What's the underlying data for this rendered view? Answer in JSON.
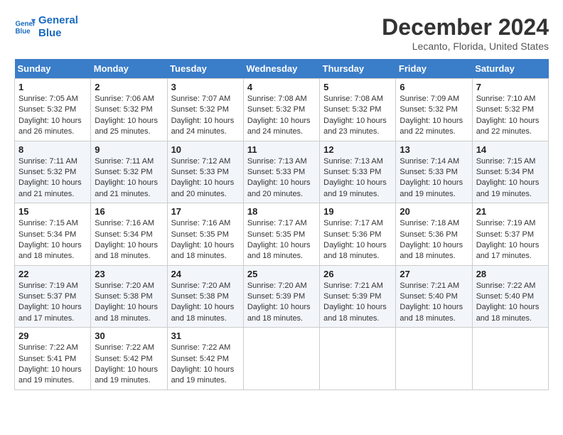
{
  "logo": {
    "line1": "General",
    "line2": "Blue"
  },
  "title": "December 2024",
  "location": "Lecanto, Florida, United States",
  "columns": [
    "Sunday",
    "Monday",
    "Tuesday",
    "Wednesday",
    "Thursday",
    "Friday",
    "Saturday"
  ],
  "weeks": [
    [
      {
        "day": "1",
        "sunrise": "7:05 AM",
        "sunset": "5:32 PM",
        "daylight": "10 hours and 26 minutes."
      },
      {
        "day": "2",
        "sunrise": "7:06 AM",
        "sunset": "5:32 PM",
        "daylight": "10 hours and 25 minutes."
      },
      {
        "day": "3",
        "sunrise": "7:07 AM",
        "sunset": "5:32 PM",
        "daylight": "10 hours and 24 minutes."
      },
      {
        "day": "4",
        "sunrise": "7:08 AM",
        "sunset": "5:32 PM",
        "daylight": "10 hours and 24 minutes."
      },
      {
        "day": "5",
        "sunrise": "7:08 AM",
        "sunset": "5:32 PM",
        "daylight": "10 hours and 23 minutes."
      },
      {
        "day": "6",
        "sunrise": "7:09 AM",
        "sunset": "5:32 PM",
        "daylight": "10 hours and 22 minutes."
      },
      {
        "day": "7",
        "sunrise": "7:10 AM",
        "sunset": "5:32 PM",
        "daylight": "10 hours and 22 minutes."
      }
    ],
    [
      {
        "day": "8",
        "sunrise": "7:11 AM",
        "sunset": "5:32 PM",
        "daylight": "10 hours and 21 minutes."
      },
      {
        "day": "9",
        "sunrise": "7:11 AM",
        "sunset": "5:32 PM",
        "daylight": "10 hours and 21 minutes."
      },
      {
        "day": "10",
        "sunrise": "7:12 AM",
        "sunset": "5:33 PM",
        "daylight": "10 hours and 20 minutes."
      },
      {
        "day": "11",
        "sunrise": "7:13 AM",
        "sunset": "5:33 PM",
        "daylight": "10 hours and 20 minutes."
      },
      {
        "day": "12",
        "sunrise": "7:13 AM",
        "sunset": "5:33 PM",
        "daylight": "10 hours and 19 minutes."
      },
      {
        "day": "13",
        "sunrise": "7:14 AM",
        "sunset": "5:33 PM",
        "daylight": "10 hours and 19 minutes."
      },
      {
        "day": "14",
        "sunrise": "7:15 AM",
        "sunset": "5:34 PM",
        "daylight": "10 hours and 19 minutes."
      }
    ],
    [
      {
        "day": "15",
        "sunrise": "7:15 AM",
        "sunset": "5:34 PM",
        "daylight": "10 hours and 18 minutes."
      },
      {
        "day": "16",
        "sunrise": "7:16 AM",
        "sunset": "5:34 PM",
        "daylight": "10 hours and 18 minutes."
      },
      {
        "day": "17",
        "sunrise": "7:16 AM",
        "sunset": "5:35 PM",
        "daylight": "10 hours and 18 minutes."
      },
      {
        "day": "18",
        "sunrise": "7:17 AM",
        "sunset": "5:35 PM",
        "daylight": "10 hours and 18 minutes."
      },
      {
        "day": "19",
        "sunrise": "7:17 AM",
        "sunset": "5:36 PM",
        "daylight": "10 hours and 18 minutes."
      },
      {
        "day": "20",
        "sunrise": "7:18 AM",
        "sunset": "5:36 PM",
        "daylight": "10 hours and 18 minutes."
      },
      {
        "day": "21",
        "sunrise": "7:19 AM",
        "sunset": "5:37 PM",
        "daylight": "10 hours and 17 minutes."
      }
    ],
    [
      {
        "day": "22",
        "sunrise": "7:19 AM",
        "sunset": "5:37 PM",
        "daylight": "10 hours and 17 minutes."
      },
      {
        "day": "23",
        "sunrise": "7:20 AM",
        "sunset": "5:38 PM",
        "daylight": "10 hours and 18 minutes."
      },
      {
        "day": "24",
        "sunrise": "7:20 AM",
        "sunset": "5:38 PM",
        "daylight": "10 hours and 18 minutes."
      },
      {
        "day": "25",
        "sunrise": "7:20 AM",
        "sunset": "5:39 PM",
        "daylight": "10 hours and 18 minutes."
      },
      {
        "day": "26",
        "sunrise": "7:21 AM",
        "sunset": "5:39 PM",
        "daylight": "10 hours and 18 minutes."
      },
      {
        "day": "27",
        "sunrise": "7:21 AM",
        "sunset": "5:40 PM",
        "daylight": "10 hours and 18 minutes."
      },
      {
        "day": "28",
        "sunrise": "7:22 AM",
        "sunset": "5:40 PM",
        "daylight": "10 hours and 18 minutes."
      }
    ],
    [
      {
        "day": "29",
        "sunrise": "7:22 AM",
        "sunset": "5:41 PM",
        "daylight": "10 hours and 19 minutes."
      },
      {
        "day": "30",
        "sunrise": "7:22 AM",
        "sunset": "5:42 PM",
        "daylight": "10 hours and 19 minutes."
      },
      {
        "day": "31",
        "sunrise": "7:22 AM",
        "sunset": "5:42 PM",
        "daylight": "10 hours and 19 minutes."
      },
      null,
      null,
      null,
      null
    ]
  ],
  "labels": {
    "sunrise": "Sunrise:",
    "sunset": "Sunset:",
    "daylight": "Daylight:"
  }
}
